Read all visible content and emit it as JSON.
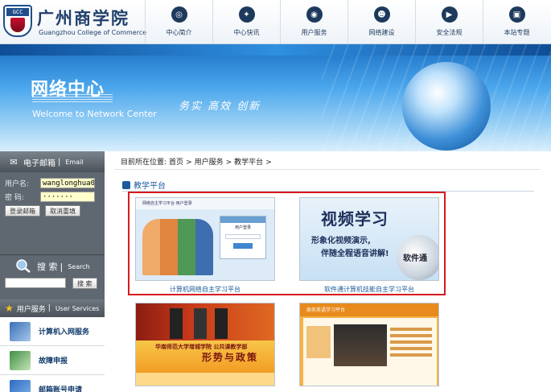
{
  "header": {
    "logo_text": "广州商学院",
    "logo_en": "Guangzhou College of Commerce",
    "logo_badge": "GCC",
    "nav": [
      {
        "label": "中心简介",
        "icon": "info-icon"
      },
      {
        "label": "中心快讯",
        "icon": "news-icon"
      },
      {
        "label": "用户服务",
        "icon": "target-icon"
      },
      {
        "label": "网络建设",
        "icon": "network-icon"
      },
      {
        "label": "安全法规",
        "icon": "shield-icon"
      },
      {
        "label": "本站专题",
        "icon": "monitor-icon"
      }
    ]
  },
  "banner": {
    "title": "网络中心",
    "subtitle": "Welcome to Network Center",
    "slogan": "务实 高效 创新"
  },
  "sidebar": {
    "mail": {
      "title": "电子邮箱",
      "title_en": "Email",
      "username_label": "用户名:",
      "username_value": "wanglonghua00",
      "password_label": "密  码:",
      "password_value": "·······",
      "login_button": "登录邮箱",
      "reset_button": "取消重填"
    },
    "search": {
      "title": "搜 索",
      "title_en": "Search",
      "button": "搜 索"
    },
    "services": {
      "title": "用户服务",
      "title_en": "User Services",
      "items": [
        {
          "label": "计算机入网服务",
          "icon": "laptop-icon"
        },
        {
          "label": "故障申报",
          "icon": "repair-icon"
        },
        {
          "label": "邮箱账号申请",
          "icon": "folder-icon"
        }
      ]
    }
  },
  "main": {
    "breadcrumb": {
      "prefix": "目前所在位置:",
      "items": [
        "首页",
        "用户服务",
        "教学平台"
      ]
    },
    "section_title": "教学平台",
    "cards": [
      {
        "caption": "计算机网络自主学习平台",
        "thumb_header": "网络自主学习平台·用户登录",
        "thumb_panel_title": "用户登录",
        "thumb_button": "登录"
      },
      {
        "caption": "软件通计算机技能自主学习平台",
        "thumb_title": "视频学习",
        "thumb_line1": "形象化视频演示,",
        "thumb_line2": "伴随全程语音讲解!",
        "thumb_badge": "软件通"
      },
      {
        "caption": "",
        "thumb_line1": "华南师范大学增城学院 公共课教学部",
        "thumb_title": "形势与政策"
      },
      {
        "caption": "",
        "thumb_title": "商务英语学习平台"
      }
    ]
  },
  "colors": {
    "brand_blue": "#1f3e6a",
    "sidebar_gray": "#58606a",
    "highlight_red": "#d8191e",
    "link_blue": "#1d5b99"
  }
}
